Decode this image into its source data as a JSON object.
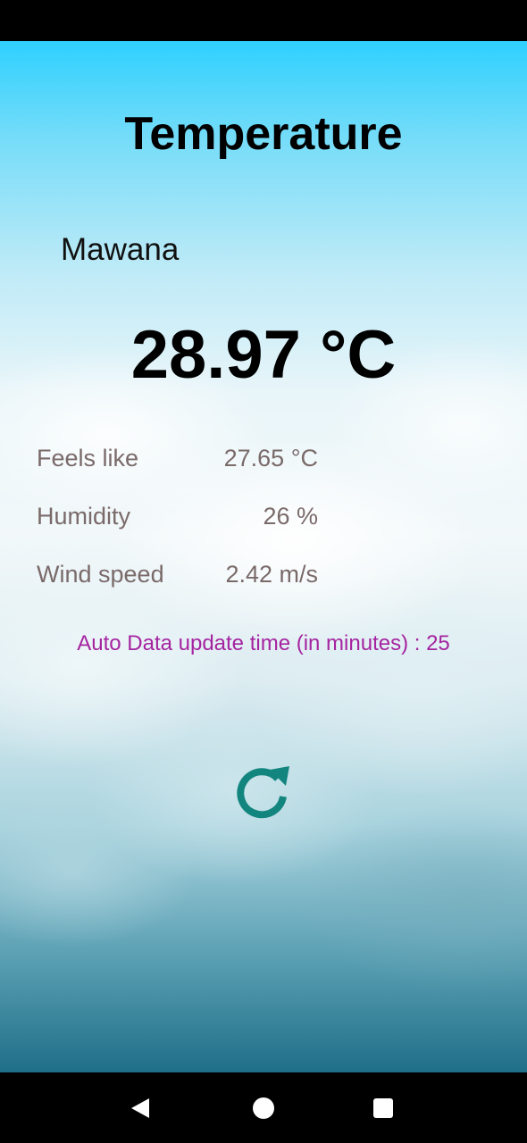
{
  "app": {
    "title": "Temperature"
  },
  "weather": {
    "city": "Mawana",
    "temperature": "28.97 °C",
    "details": [
      {
        "label": "Feels like",
        "value": "27.65 °C"
      },
      {
        "label": "Humidity",
        "value": "26 %"
      },
      {
        "label": "Wind speed",
        "value": "2.42 m/s"
      }
    ],
    "update_note": "Auto Data update time (in minutes) : 25"
  },
  "icons": {
    "refresh": "refresh-icon",
    "back": "back-icon",
    "home": "home-icon",
    "recents": "recents-icon"
  },
  "colors": {
    "refresh_icon": "#13857f",
    "update_note": "#a524a0",
    "detail_text": "#7a6a6a"
  }
}
